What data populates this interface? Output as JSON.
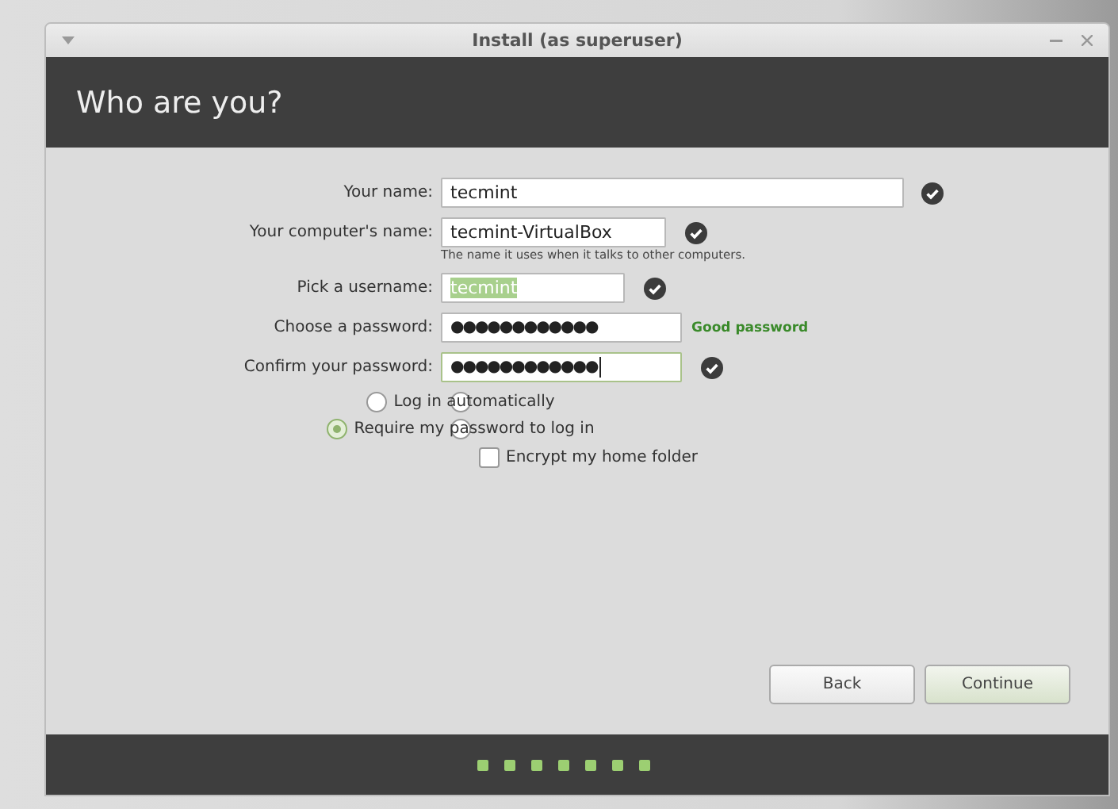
{
  "window": {
    "title": "Install (as superuser)"
  },
  "header": {
    "title": "Who are you?"
  },
  "fields": [
    {
      "label": "Your name:",
      "value": "tecmint",
      "kind": "text",
      "valid": true,
      "highlighted": false,
      "focused": false
    },
    {
      "label": "Your computer's name:",
      "value": "tecmint-VirtualBox",
      "kind": "text",
      "valid": true,
      "highlighted": false,
      "focused": false,
      "hint": "The name it uses when it talks to other computers."
    },
    {
      "label": "Pick a username:",
      "value": "tecmint",
      "kind": "text",
      "valid": true,
      "highlighted": true,
      "focused": false
    },
    {
      "label": "Choose a password:",
      "value": "●●●●●●●●●●●●",
      "kind": "password",
      "valid": false,
      "highlighted": false,
      "focused": false,
      "strength": "Good password"
    },
    {
      "label": "Confirm your password:",
      "value": "●●●●●●●●●●●●",
      "kind": "password",
      "valid": true,
      "highlighted": false,
      "focused": true
    }
  ],
  "options": [
    {
      "kind": "radio",
      "label": "Log in automatically",
      "selected": false
    },
    {
      "kind": "radio",
      "label": "Require my password to log in",
      "selected": true
    },
    {
      "kind": "checkbox",
      "label": "Encrypt my home folder",
      "checked": false
    }
  ],
  "buttons": [
    {
      "label": "Back",
      "default": false
    },
    {
      "label": "Continue",
      "default": true
    }
  ],
  "progress": [
    {
      "done": true
    },
    {
      "done": true
    },
    {
      "done": true
    },
    {
      "done": true
    },
    {
      "done": true
    },
    {
      "done": true
    },
    {
      "done": true
    }
  ]
}
